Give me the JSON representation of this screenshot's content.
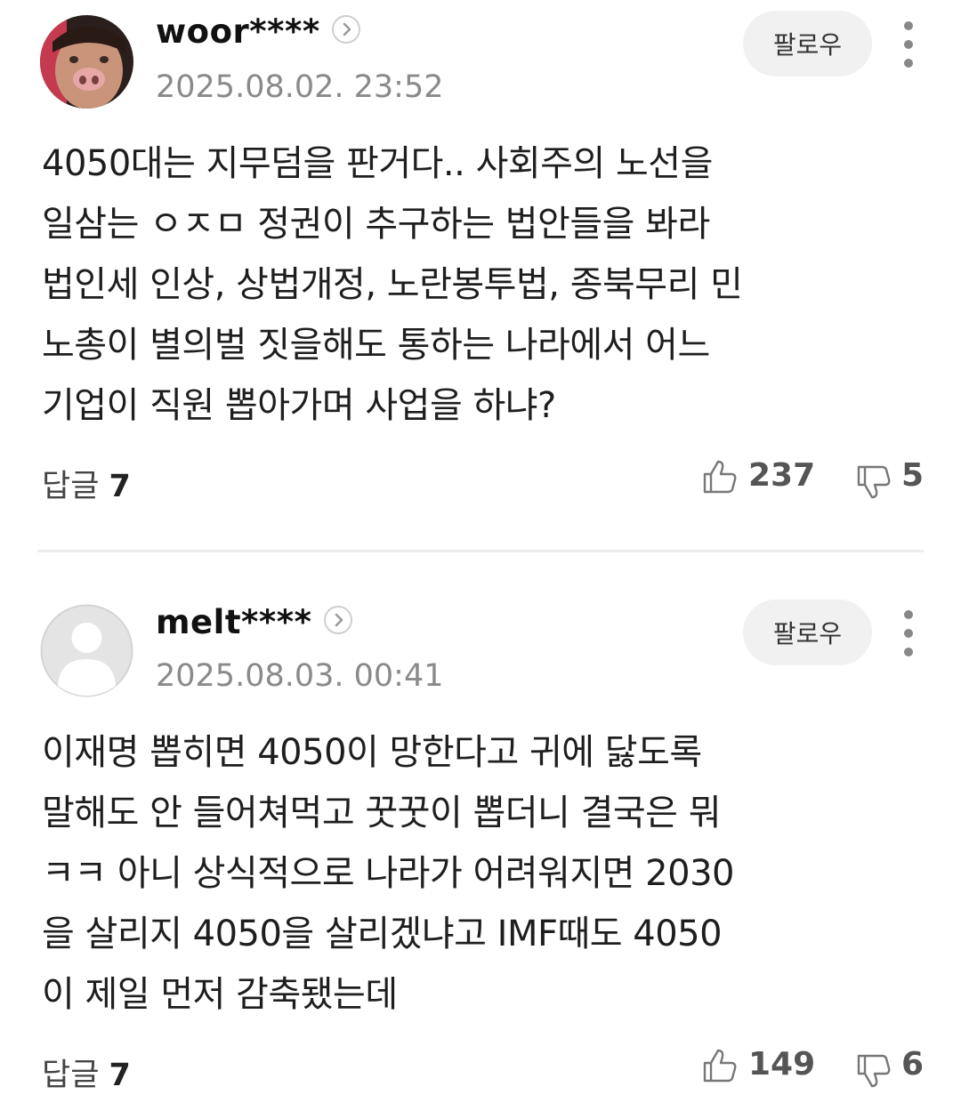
{
  "comments": [
    {
      "username": "woor****",
      "date": "2025.08.02. 23:52",
      "follow_label": "팔로우",
      "body_lines": [
        "4050대는 지무덤을 판거다.. 사회주의 노선을",
        "일삼는 ㅇㅈㅁ 정권이 추구하는 법안들을 봐라",
        "법인세 인상, 상법개정, 노란봉투법, 종북무리 민",
        "노총이 별의벌 짓을해도 통하는 나라에서 어느",
        "기업이 직원 뽑아가며 사업을 하냐?"
      ],
      "replies_label": "답글",
      "replies_count": "7",
      "likes": "237",
      "dislikes": "5"
    },
    {
      "username": "melt****",
      "date": "2025.08.03. 00:41",
      "follow_label": "팔로우",
      "body_lines": [
        "이재명 뽑히면 4050이 망한다고 귀에 닳도록",
        "말해도 안 들어쳐먹고 꿋꿋이 뽑더니 결국은 뭐",
        "ㅋㅋ 아니 상식적으로 나라가 어려워지면 2030",
        "을 살리지 4050을 살리겠냐고 IMF때도 4050",
        "이 제일 먼저 감축됐는데"
      ],
      "replies_label": "답글",
      "replies_count": "7",
      "likes": "149",
      "dislikes": "6"
    }
  ],
  "icons": {
    "like": "thumbs-up-icon",
    "dislike": "thumbs-down-icon",
    "more": "more-vertical-icon",
    "chevron": "chevron-right-icon"
  }
}
